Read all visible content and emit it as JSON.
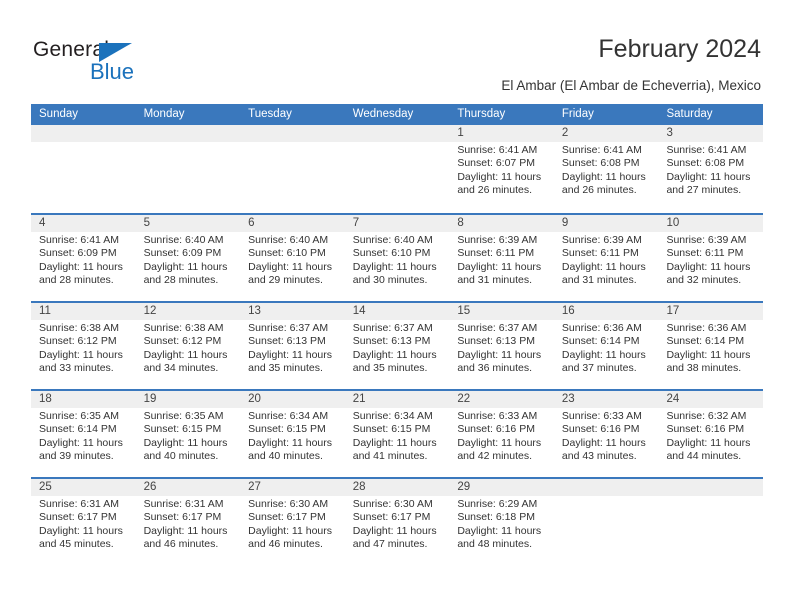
{
  "brand": {
    "name_dark": "General",
    "name_blue": "Blue",
    "accent_color": "#1b72bc"
  },
  "header": {
    "title": "February 2024",
    "subtitle": "El Ambar (El Ambar de Echeverria), Mexico"
  },
  "calendar": {
    "header_bg": "#3a78bd",
    "number_band_bg": "#efefef",
    "weekdays": [
      "Sunday",
      "Monday",
      "Tuesday",
      "Wednesday",
      "Thursday",
      "Friday",
      "Saturday"
    ],
    "weeks": [
      [
        {
          "day": "",
          "sunrise": "",
          "sunset": "",
          "daylight": "",
          "daylight2": ""
        },
        {
          "day": "",
          "sunrise": "",
          "sunset": "",
          "daylight": "",
          "daylight2": ""
        },
        {
          "day": "",
          "sunrise": "",
          "sunset": "",
          "daylight": "",
          "daylight2": ""
        },
        {
          "day": "",
          "sunrise": "",
          "sunset": "",
          "daylight": "",
          "daylight2": ""
        },
        {
          "day": "1",
          "sunrise": "Sunrise: 6:41 AM",
          "sunset": "Sunset: 6:07 PM",
          "daylight": "Daylight: 11 hours",
          "daylight2": "and 26 minutes."
        },
        {
          "day": "2",
          "sunrise": "Sunrise: 6:41 AM",
          "sunset": "Sunset: 6:08 PM",
          "daylight": "Daylight: 11 hours",
          "daylight2": "and 26 minutes."
        },
        {
          "day": "3",
          "sunrise": "Sunrise: 6:41 AM",
          "sunset": "Sunset: 6:08 PM",
          "daylight": "Daylight: 11 hours",
          "daylight2": "and 27 minutes."
        }
      ],
      [
        {
          "day": "4",
          "sunrise": "Sunrise: 6:41 AM",
          "sunset": "Sunset: 6:09 PM",
          "daylight": "Daylight: 11 hours",
          "daylight2": "and 28 minutes."
        },
        {
          "day": "5",
          "sunrise": "Sunrise: 6:40 AM",
          "sunset": "Sunset: 6:09 PM",
          "daylight": "Daylight: 11 hours",
          "daylight2": "and 28 minutes."
        },
        {
          "day": "6",
          "sunrise": "Sunrise: 6:40 AM",
          "sunset": "Sunset: 6:10 PM",
          "daylight": "Daylight: 11 hours",
          "daylight2": "and 29 minutes."
        },
        {
          "day": "7",
          "sunrise": "Sunrise: 6:40 AM",
          "sunset": "Sunset: 6:10 PM",
          "daylight": "Daylight: 11 hours",
          "daylight2": "and 30 minutes."
        },
        {
          "day": "8",
          "sunrise": "Sunrise: 6:39 AM",
          "sunset": "Sunset: 6:11 PM",
          "daylight": "Daylight: 11 hours",
          "daylight2": "and 31 minutes."
        },
        {
          "day": "9",
          "sunrise": "Sunrise: 6:39 AM",
          "sunset": "Sunset: 6:11 PM",
          "daylight": "Daylight: 11 hours",
          "daylight2": "and 31 minutes."
        },
        {
          "day": "10",
          "sunrise": "Sunrise: 6:39 AM",
          "sunset": "Sunset: 6:11 PM",
          "daylight": "Daylight: 11 hours",
          "daylight2": "and 32 minutes."
        }
      ],
      [
        {
          "day": "11",
          "sunrise": "Sunrise: 6:38 AM",
          "sunset": "Sunset: 6:12 PM",
          "daylight": "Daylight: 11 hours",
          "daylight2": "and 33 minutes."
        },
        {
          "day": "12",
          "sunrise": "Sunrise: 6:38 AM",
          "sunset": "Sunset: 6:12 PM",
          "daylight": "Daylight: 11 hours",
          "daylight2": "and 34 minutes."
        },
        {
          "day": "13",
          "sunrise": "Sunrise: 6:37 AM",
          "sunset": "Sunset: 6:13 PM",
          "daylight": "Daylight: 11 hours",
          "daylight2": "and 35 minutes."
        },
        {
          "day": "14",
          "sunrise": "Sunrise: 6:37 AM",
          "sunset": "Sunset: 6:13 PM",
          "daylight": "Daylight: 11 hours",
          "daylight2": "and 35 minutes."
        },
        {
          "day": "15",
          "sunrise": "Sunrise: 6:37 AM",
          "sunset": "Sunset: 6:13 PM",
          "daylight": "Daylight: 11 hours",
          "daylight2": "and 36 minutes."
        },
        {
          "day": "16",
          "sunrise": "Sunrise: 6:36 AM",
          "sunset": "Sunset: 6:14 PM",
          "daylight": "Daylight: 11 hours",
          "daylight2": "and 37 minutes."
        },
        {
          "day": "17",
          "sunrise": "Sunrise: 6:36 AM",
          "sunset": "Sunset: 6:14 PM",
          "daylight": "Daylight: 11 hours",
          "daylight2": "and 38 minutes."
        }
      ],
      [
        {
          "day": "18",
          "sunrise": "Sunrise: 6:35 AM",
          "sunset": "Sunset: 6:14 PM",
          "daylight": "Daylight: 11 hours",
          "daylight2": "and 39 minutes."
        },
        {
          "day": "19",
          "sunrise": "Sunrise: 6:35 AM",
          "sunset": "Sunset: 6:15 PM",
          "daylight": "Daylight: 11 hours",
          "daylight2": "and 40 minutes."
        },
        {
          "day": "20",
          "sunrise": "Sunrise: 6:34 AM",
          "sunset": "Sunset: 6:15 PM",
          "daylight": "Daylight: 11 hours",
          "daylight2": "and 40 minutes."
        },
        {
          "day": "21",
          "sunrise": "Sunrise: 6:34 AM",
          "sunset": "Sunset: 6:15 PM",
          "daylight": "Daylight: 11 hours",
          "daylight2": "and 41 minutes."
        },
        {
          "day": "22",
          "sunrise": "Sunrise: 6:33 AM",
          "sunset": "Sunset: 6:16 PM",
          "daylight": "Daylight: 11 hours",
          "daylight2": "and 42 minutes."
        },
        {
          "day": "23",
          "sunrise": "Sunrise: 6:33 AM",
          "sunset": "Sunset: 6:16 PM",
          "daylight": "Daylight: 11 hours",
          "daylight2": "and 43 minutes."
        },
        {
          "day": "24",
          "sunrise": "Sunrise: 6:32 AM",
          "sunset": "Sunset: 6:16 PM",
          "daylight": "Daylight: 11 hours",
          "daylight2": "and 44 minutes."
        }
      ],
      [
        {
          "day": "25",
          "sunrise": "Sunrise: 6:31 AM",
          "sunset": "Sunset: 6:17 PM",
          "daylight": "Daylight: 11 hours",
          "daylight2": "and 45 minutes."
        },
        {
          "day": "26",
          "sunrise": "Sunrise: 6:31 AM",
          "sunset": "Sunset: 6:17 PM",
          "daylight": "Daylight: 11 hours",
          "daylight2": "and 46 minutes."
        },
        {
          "day": "27",
          "sunrise": "Sunrise: 6:30 AM",
          "sunset": "Sunset: 6:17 PM",
          "daylight": "Daylight: 11 hours",
          "daylight2": "and 46 minutes."
        },
        {
          "day": "28",
          "sunrise": "Sunrise: 6:30 AM",
          "sunset": "Sunset: 6:17 PM",
          "daylight": "Daylight: 11 hours",
          "daylight2": "and 47 minutes."
        },
        {
          "day": "29",
          "sunrise": "Sunrise: 6:29 AM",
          "sunset": "Sunset: 6:18 PM",
          "daylight": "Daylight: 11 hours",
          "daylight2": "and 48 minutes."
        },
        {
          "day": "",
          "sunrise": "",
          "sunset": "",
          "daylight": "",
          "daylight2": ""
        },
        {
          "day": "",
          "sunrise": "",
          "sunset": "",
          "daylight": "",
          "daylight2": ""
        }
      ]
    ]
  }
}
